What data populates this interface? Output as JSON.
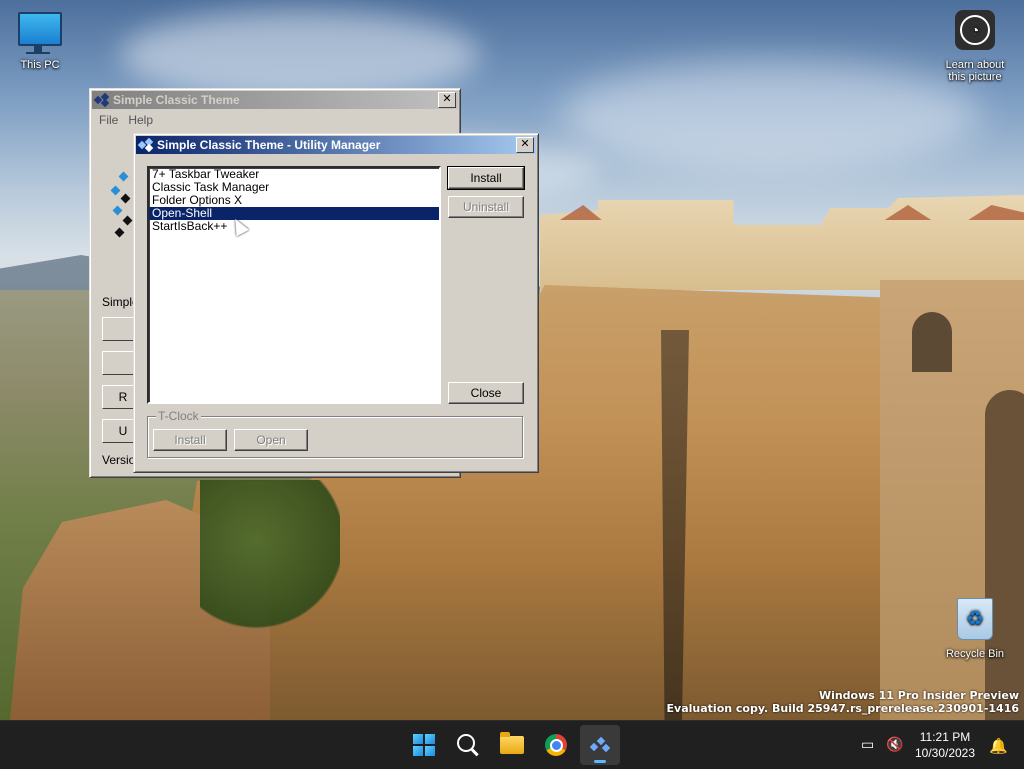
{
  "desktop": {
    "icons": [
      {
        "label": "This PC"
      },
      {
        "label": "Learn about this picture"
      },
      {
        "label": "Recycle Bin"
      }
    ],
    "watermark": {
      "line1": "Windows 11 Pro Insider Preview",
      "line2": "Evaluation copy. Build 25947.rs_prerelease.230901-1416"
    }
  },
  "background_window": {
    "title": "Simple Classic Theme",
    "menu": [
      "File",
      "Help"
    ],
    "partial_texts": [
      "Simple",
      "Version"
    ],
    "partial_buttons": [
      "",
      "",
      "R",
      "U"
    ]
  },
  "dialog": {
    "title": "Simple Classic Theme - Utility Manager",
    "list_items": [
      "7+ Taskbar Tweaker",
      "Classic Task Manager",
      "Folder Options X",
      "Open-Shell",
      "StartIsBack++"
    ],
    "selected_index": 3,
    "buttons": {
      "install": "Install",
      "uninstall": "Uninstall",
      "close": "Close"
    },
    "group": {
      "label": "T-Clock",
      "install": "Install",
      "open": "Open"
    }
  },
  "taskbar": {
    "time": "11:21 PM",
    "date": "10/30/2023",
    "apps": [
      "start-icon",
      "search-icon",
      "file-explorer-icon",
      "chrome-icon",
      "simple-classic-theme-icon"
    ]
  }
}
